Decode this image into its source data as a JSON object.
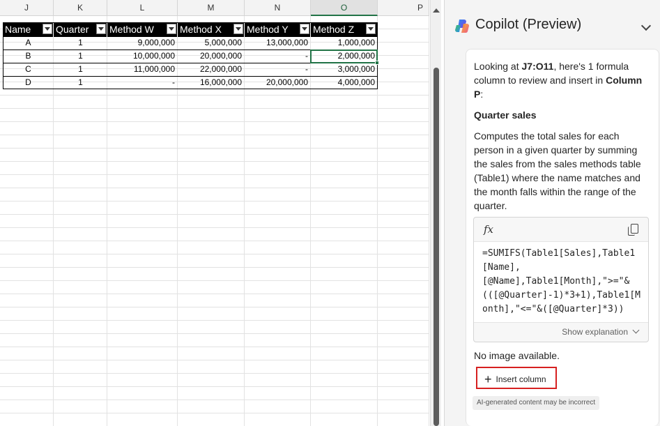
{
  "sheet": {
    "columns": [
      "J",
      "K",
      "L",
      "M",
      "N",
      "O",
      "P"
    ],
    "selected_column": "O",
    "table_headers": [
      "Name",
      "Quarter",
      "Method W",
      "Method X",
      "Method Y",
      "Method Z"
    ],
    "rows": [
      [
        "A",
        "1",
        "9,000,000",
        "5,000,000",
        "13,000,000",
        "1,000,000"
      ],
      [
        "B",
        "1",
        "10,000,000",
        "20,000,000",
        "-",
        "2,000,000"
      ],
      [
        "C",
        "1",
        "11,000,000",
        "22,000,000",
        "-",
        "3,000,000"
      ],
      [
        "D",
        "1",
        "-",
        "16,000,000",
        "20,000,000",
        "4,000,000"
      ]
    ]
  },
  "copilot": {
    "title": "Copilot (Preview)",
    "intro_pre": "Looking at ",
    "intro_range": "J7:O11",
    "intro_mid": ", here's 1 formula column to review and insert in ",
    "intro_col": "Column P",
    "intro_post": ":",
    "heading": "Quarter sales",
    "description": "Computes the total sales for each person in a given quarter by summing the sales from the sales methods table (Table1) where the name matches and the month falls within the range of the quarter.",
    "fx_label": "fx",
    "formula": "=SUMIFS(Table1[Sales],Table1[Name],\n[@Name],Table1[Month],\">=\"&(([@Quarter]-1)*3+1),Table1[Month],\"<=\"&([@Quarter]*3))",
    "show_explanation": "Show explanation",
    "no_image": "No image available.",
    "insert_label": "Insert column",
    "ai_notice": "AI-generated content may be incorrect"
  }
}
